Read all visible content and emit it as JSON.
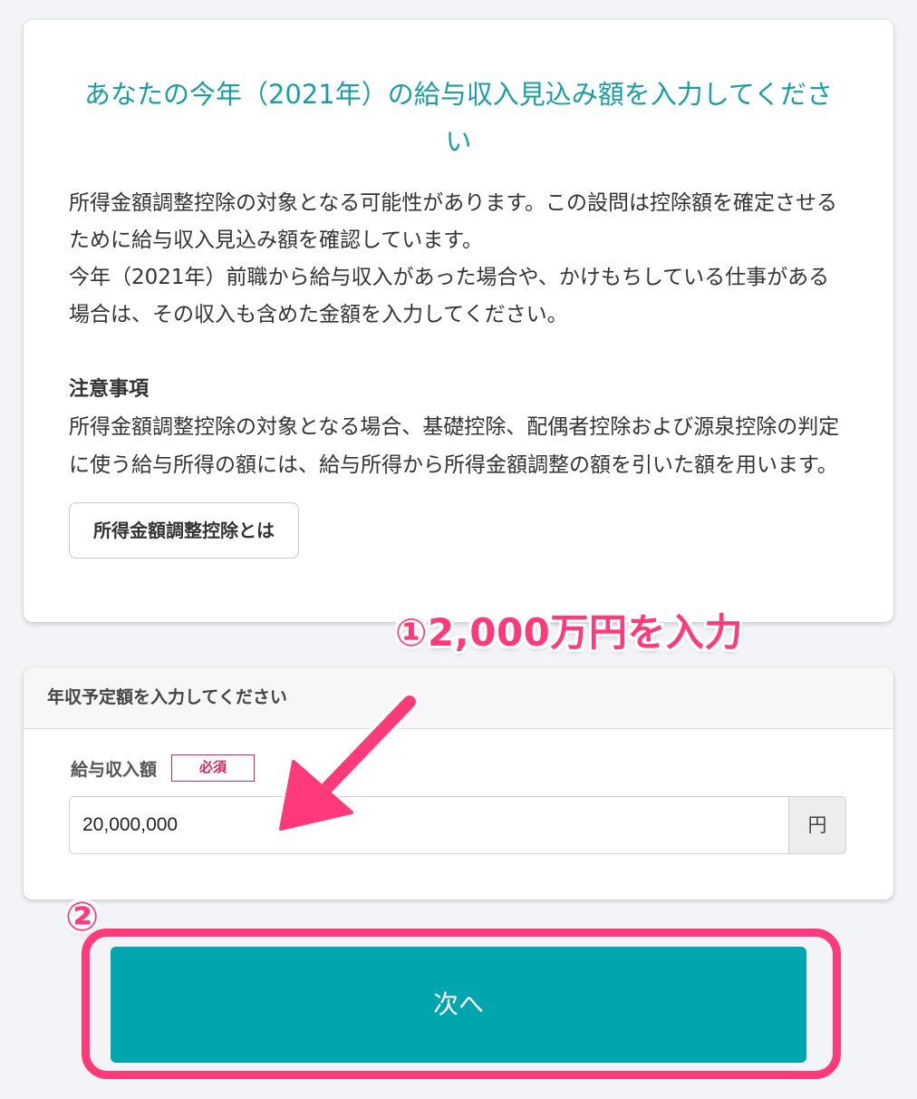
{
  "info_card": {
    "title": "あなたの今年（2021年）の給与収入見込み額を入力してください",
    "description": [
      "所得金額調整控除の対象となる可能性があります。この設問は控除額を確定させるために給与収入見込み額を確認しています。",
      "今年（2021年）前職から給与収入があった場合や、かけもちしている仕事がある場合は、その収入も含めた金額を入力してください。"
    ],
    "notes_title": "注意事項",
    "notes_body": "所得金額調整控除の対象となる場合、基礎控除、配偶者控除および源泉控除の判定に使う給与所得の額には、給与所得から所得金額調整の額を引いた額を用います。",
    "link_button_label": "所得金額調整控除とは"
  },
  "income_card": {
    "header": "年収予定額を入力してください",
    "field_label": "給与収入額",
    "required_badge": "必須",
    "input_value": "20,000,000",
    "unit": "円"
  },
  "next_button_label": "次へ",
  "annotations": {
    "step1": "①2,000万円を入力",
    "step2": "②",
    "color": "#ff3a7a"
  },
  "colors": {
    "accent": "#00a5ad",
    "title": "#1a9ea5",
    "required": "#d6285a"
  }
}
